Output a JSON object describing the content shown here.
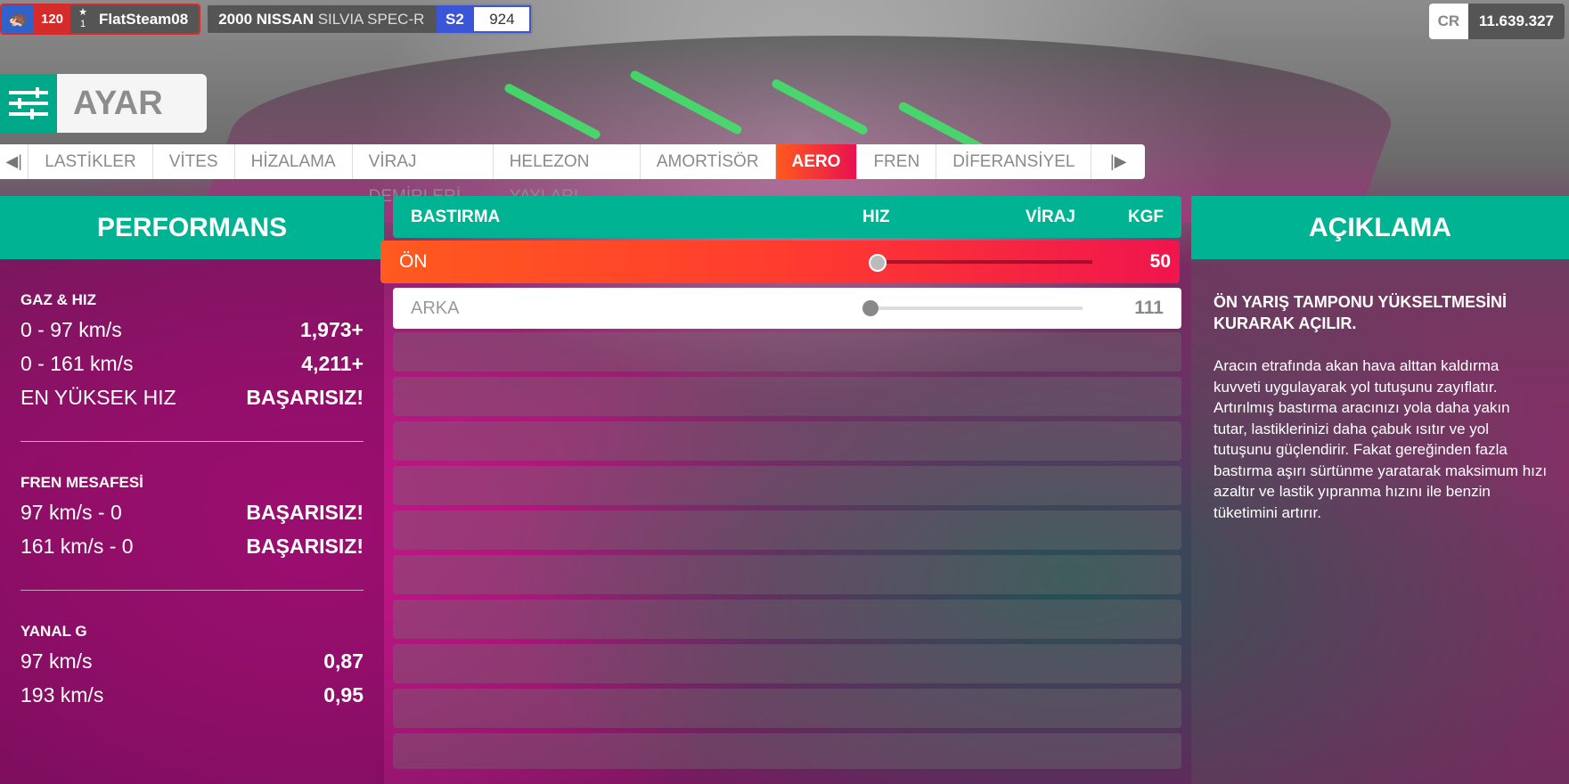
{
  "topbar": {
    "level": "120",
    "stars": "1",
    "gamertag": "FlatSteam08",
    "car_year_make": "2000 NISSAN",
    "car_model": "SILVIA SPEC-R",
    "car_class": "S2",
    "car_pi": "924",
    "colors": {
      "class": "#3a55d6",
      "level": "#d62b2b"
    }
  },
  "credits": {
    "label": "CR",
    "value": "11.639.327"
  },
  "section": {
    "title": "AYAR",
    "icon": "sliders-icon"
  },
  "tabs": {
    "prev_icon": "◀|",
    "next_icon": "|▶",
    "items": [
      "LASTİKLER",
      "VİTES",
      "HİZALAMA",
      "VİRAJ DEMİRLERİ",
      "HELEZON YAYLARI",
      "AMORTİSÖR",
      "AERO",
      "FREN",
      "DİFERANSİYEL"
    ],
    "active": "AERO"
  },
  "performance": {
    "title": "PERFORMANS",
    "groups": [
      {
        "heading": "GAZ & HIZ",
        "rows": [
          {
            "label": "0 - 97 km/s",
            "value": "1,973+"
          },
          {
            "label": "0 - 161 km/s",
            "value": "4,211+"
          },
          {
            "label": "EN YÜKSEK HIZ",
            "value": "BAŞARISIZ!"
          }
        ]
      },
      {
        "heading": "FREN MESAFESİ",
        "rows": [
          {
            "label": "97 km/s - 0",
            "value": "BAŞARISIZ!"
          },
          {
            "label": "161 km/s - 0",
            "value": "BAŞARISIZ!"
          }
        ]
      },
      {
        "heading": "YANAL G",
        "rows": [
          {
            "label": "97 km/s",
            "value": "0,87"
          },
          {
            "label": "193 km/s",
            "value": "0,95"
          }
        ]
      }
    ]
  },
  "downforce": {
    "header": {
      "title": "BASTIRMA",
      "left": "HIZ",
      "right": "VİRAJ",
      "unit": "KGF"
    },
    "front": {
      "label": "ÖN",
      "value": "50",
      "slider_fraction": 0.0
    },
    "rear": {
      "label": "ARKA",
      "value": "111",
      "slider_fraction": 0.0
    }
  },
  "description": {
    "title": "AÇIKLAMA",
    "subtitle": "ÖN YARIŞ TAMPONU YÜKSELTMESİNİ KURARAK AÇILIR.",
    "body": "Aracın etrafında akan hava alttan kaldırma kuvveti uygulayarak yol tutuşunu zayıflatır. Artırılmış bastırma aracınızı yola daha yakın tutar, lastiklerinizi daha çabuk ısıtır ve yol tutuşunu güçlendirir. Fakat gereğinden fazla bastırma aşırı sürtünme yaratarak maksimum hızı azaltır ve lastik yıpranma hızını ile benzin tüketimini artırır."
  }
}
